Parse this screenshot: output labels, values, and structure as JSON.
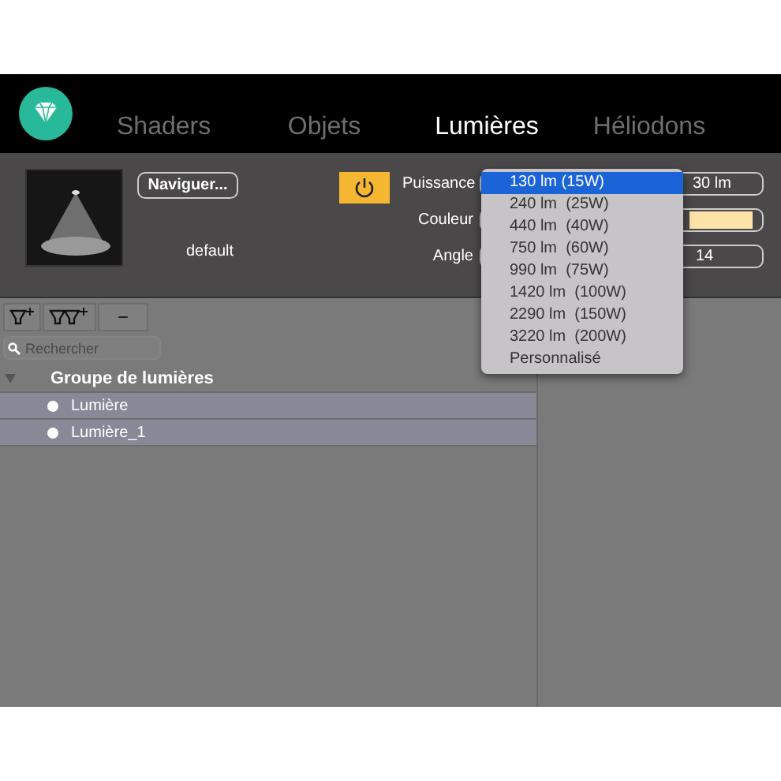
{
  "tabs": [
    {
      "label": "Shaders",
      "selected": false
    },
    {
      "label": "Objets",
      "selected": false
    },
    {
      "label": "Lumières",
      "selected": true
    },
    {
      "label": "Héliodons",
      "selected": false
    }
  ],
  "light": {
    "browse_button": "Naviguer...",
    "name": "default",
    "power_on": true
  },
  "properties": [
    {
      "kind": "power",
      "label": "Puissance",
      "value": "30 lm"
    },
    {
      "kind": "color",
      "label": "Couleur",
      "color": "#fde3a8"
    },
    {
      "kind": "angle",
      "label": "Angle",
      "value": "14"
    }
  ],
  "dropdown": [
    {
      "label": "130 lm (15W)",
      "selected": true
    },
    {
      "label": "240 lm  (25W)",
      "selected": false
    },
    {
      "label": "440 lm  (40W)",
      "selected": false
    },
    {
      "label": "750 lm  (60W)",
      "selected": false
    },
    {
      "label": "990 lm  (75W)",
      "selected": false
    },
    {
      "label": "1420 lm  (100W)",
      "selected": false
    },
    {
      "label": "2290 lm  (150W)",
      "selected": false
    },
    {
      "label": "3220 lm  (200W)",
      "selected": false
    },
    {
      "label": "Personnalisé",
      "selected": false
    }
  ],
  "toolbar": {
    "remove_button": "−"
  },
  "search": {
    "placeholder": "Rechercher"
  },
  "tree": {
    "label": "Groupe de lumières",
    "expanded": true,
    "children": [
      {
        "label": "Lumière",
        "selected": true
      },
      {
        "label": "Lumière_1",
        "selected": true
      }
    ]
  }
}
